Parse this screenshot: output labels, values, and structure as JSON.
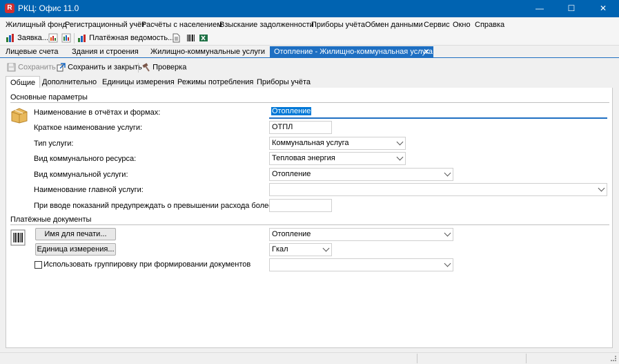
{
  "window": {
    "app_icon_letter": "R",
    "title": "РКЦ: Офис 11.0",
    "minimize": "—",
    "maximize": "☐",
    "close": "✕"
  },
  "menu": [
    "Жилищный фонд",
    "Регистрационный учёт",
    "Расчёты с населением",
    "Взыскание задолженности",
    "Приборы учёта",
    "Обмен данными",
    "Сервис",
    "Окно",
    "Справка"
  ],
  "toolbar": {
    "request_label": "Заявка...",
    "payment_statement_label": "Платёжная ведомость..."
  },
  "doc_tabs": {
    "items": [
      "Лицевые счета",
      "Здания и строения",
      "Жилищно-коммунальные услуги",
      "Отопление - Жилищно-коммунальная услуга"
    ],
    "close": "✕"
  },
  "actions": {
    "save": "Сохранить",
    "save_close": "Сохранить и закрыть",
    "check": "Проверка"
  },
  "inner_tabs": [
    "Общие",
    "Дополнительно",
    "Единицы измерения",
    "Режимы потребления",
    "Приборы учёта"
  ],
  "main_params": {
    "section_title": "Основные параметры",
    "name_label": "Наименование в отчётах и формах:",
    "name_value": "Отопление",
    "short_name_label": "Краткое наименование услуги:",
    "short_name_value": "ОТПЛ",
    "service_type_label": "Тип услуги:",
    "service_type_value": "Коммунальная услуга",
    "resource_type_label": "Вид коммунального ресурса:",
    "resource_type_value": "Тепловая энергия",
    "utility_type_label": "Вид коммунальной услуги:",
    "utility_type_value": "Отопление",
    "main_service_label": "Наименование главной услуги:",
    "main_service_value": "",
    "warn_label": "При вводе показаний предупреждать о превышении расхода более чем:",
    "warn_value": ""
  },
  "payment_docs": {
    "section_title": "Платёжные документы",
    "print_name_button": "Имя для печати...",
    "print_name_value": "Отопление",
    "unit_button": "Единица измерения...",
    "unit_value": "Гкал",
    "grouping_label": "Использовать группировку при формировании документов",
    "grouping_checked": false,
    "grouping_value": ""
  },
  "colors": {
    "titlebar": "#0063b1",
    "accent": "#1e6fc2",
    "selection": "#0078d7"
  }
}
